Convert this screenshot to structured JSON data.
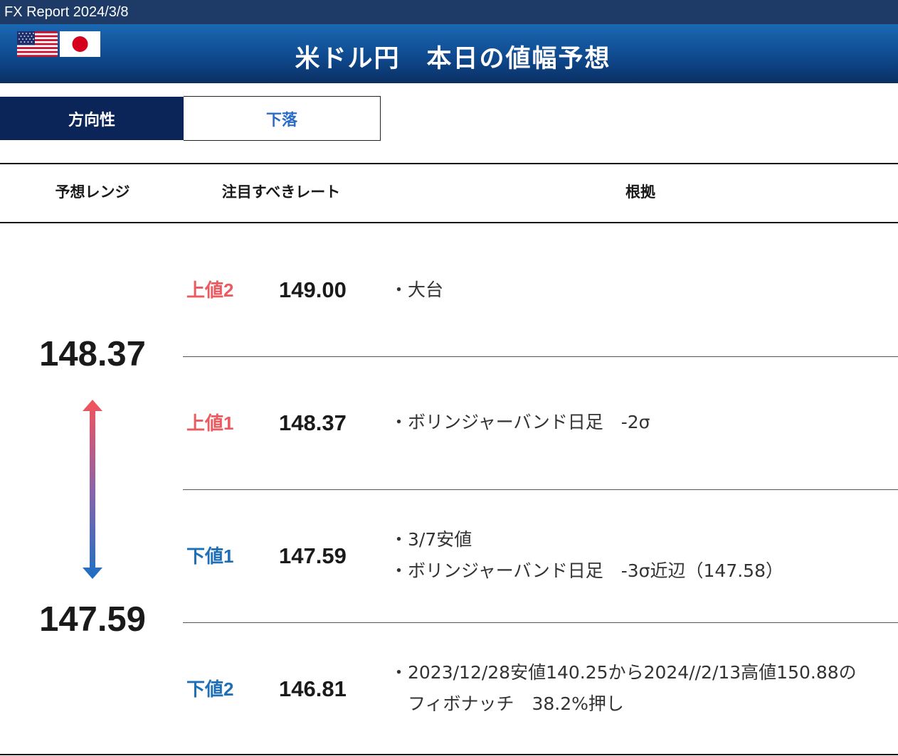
{
  "report_title": "FX Report 2024/3/8",
  "header": {
    "title": "米ドル円　本日の値幅予想",
    "flags": [
      "us-flag-icon",
      "jp-flag-icon"
    ]
  },
  "direction": {
    "label": "方向性",
    "value": "下落"
  },
  "columns": {
    "range": "予想レンジ",
    "rates": "注目すべきレート",
    "basis": "根拠"
  },
  "range": {
    "high": "148.37",
    "low": "147.59"
  },
  "levels": [
    {
      "label": "上値",
      "num": "2",
      "rate": "149.00",
      "reasons": [
        "・大台"
      ]
    },
    {
      "label": "上値",
      "num": "1",
      "rate": "148.37",
      "reasons": [
        "・ボリンジャーバンド日足　-2σ"
      ]
    },
    {
      "label": "下値",
      "num": "1",
      "rate": "147.59",
      "reasons": [
        "・3/7安値",
        "・ボリンジャーバンド日足　-3σ近辺（147.58）"
      ]
    },
    {
      "label": "下値",
      "num": "2",
      "rate": "146.81",
      "reasons": [
        "・2023/12/28安値140.25から2024//2/13高値150.88の",
        "　フィボナッチ　38.2%押し"
      ]
    }
  ],
  "colors": {
    "topbar": "#1e3a66",
    "header_top": "#1b68b3",
    "header_bottom": "#0a2f63",
    "direction_label_bg": "#0c2559",
    "direction_value": "#2a6cc7",
    "upper": "#ea5a5e",
    "lower": "#1f6fb7"
  }
}
